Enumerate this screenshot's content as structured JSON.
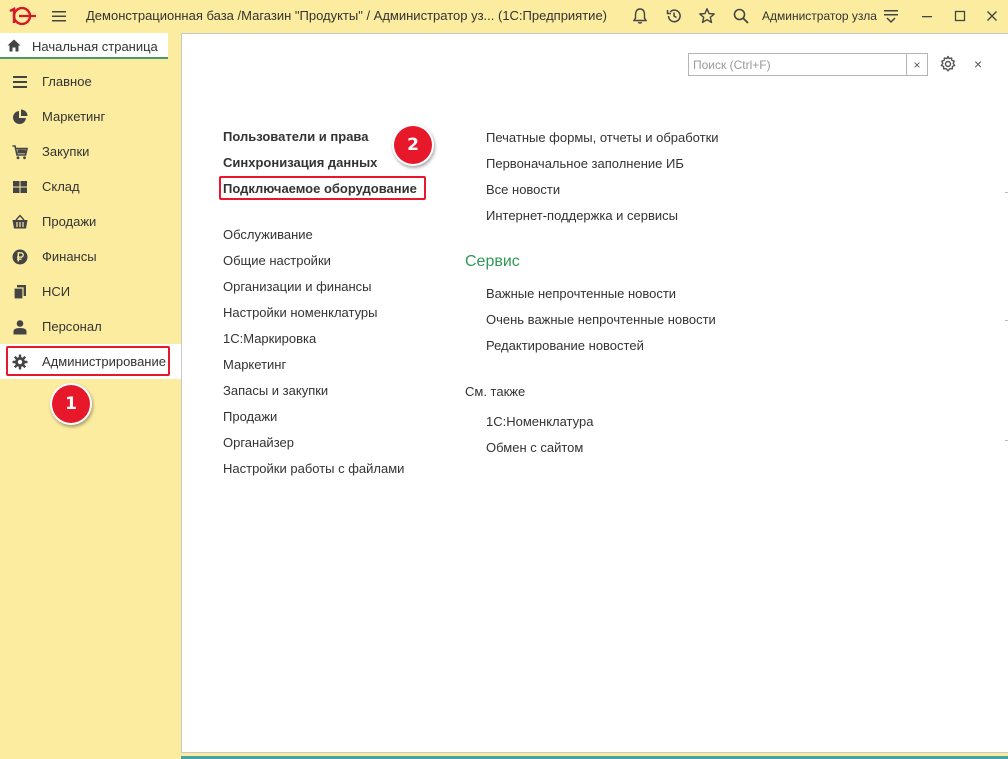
{
  "titlebar": {
    "logo_text": "1С",
    "title": "Демонстрационная база /Магазин \"Продукты\" / Администратор уз...   (1С:Предприятие)",
    "user": "Администратор узла"
  },
  "home_tab": {
    "label": "Начальная страница"
  },
  "sidebar": {
    "items": [
      {
        "label": "Главное",
        "icon": "list-icon"
      },
      {
        "label": "Маркетинг",
        "icon": "pie-chart-icon"
      },
      {
        "label": "Закупки",
        "icon": "cart-icon"
      },
      {
        "label": "Склад",
        "icon": "warehouse-icon"
      },
      {
        "label": "Продажи",
        "icon": "basket-icon"
      },
      {
        "label": "Финансы",
        "icon": "ruble-icon"
      },
      {
        "label": "НСИ",
        "icon": "documents-icon"
      },
      {
        "label": "Персонал",
        "icon": "person-icon"
      },
      {
        "label": "Администрирование",
        "icon": "gear-icon",
        "active": true
      }
    ]
  },
  "badges": {
    "one": "1",
    "two": "2"
  },
  "search": {
    "placeholder": "Поиск (Ctrl+F)",
    "value": "",
    "clear": "×"
  },
  "main": {
    "close": "×",
    "left_bold": [
      "Пользователи и права",
      "Синхронизация данных",
      "Подключаемое оборудование"
    ],
    "left_links": [
      "Обслуживание",
      "Общие настройки",
      "Организации и финансы",
      "Настройки номенклатуры",
      "1С:Маркировка",
      "Маркетинг",
      "Запасы и закупки",
      "Продажи",
      "Органайзер",
      "Настройки работы с файлами"
    ],
    "right_top_links": [
      "Печатные формы, отчеты и обработки",
      "Первоначальное заполнение ИБ",
      "Все новости",
      "Интернет-поддержка и сервисы"
    ],
    "service_title": "Сервис",
    "service_links": [
      "Важные непрочтенные новости",
      "Очень важные непрочтенные новости",
      "Редактирование новостей"
    ],
    "see_also_title": "См. также",
    "see_also_links": [
      "1С:Номенклатура",
      "Обмен с сайтом"
    ]
  },
  "colors": {
    "panel_yellow": "#fbec9f",
    "highlight_red": "#e8182b",
    "section_green": "#2f9a55"
  }
}
